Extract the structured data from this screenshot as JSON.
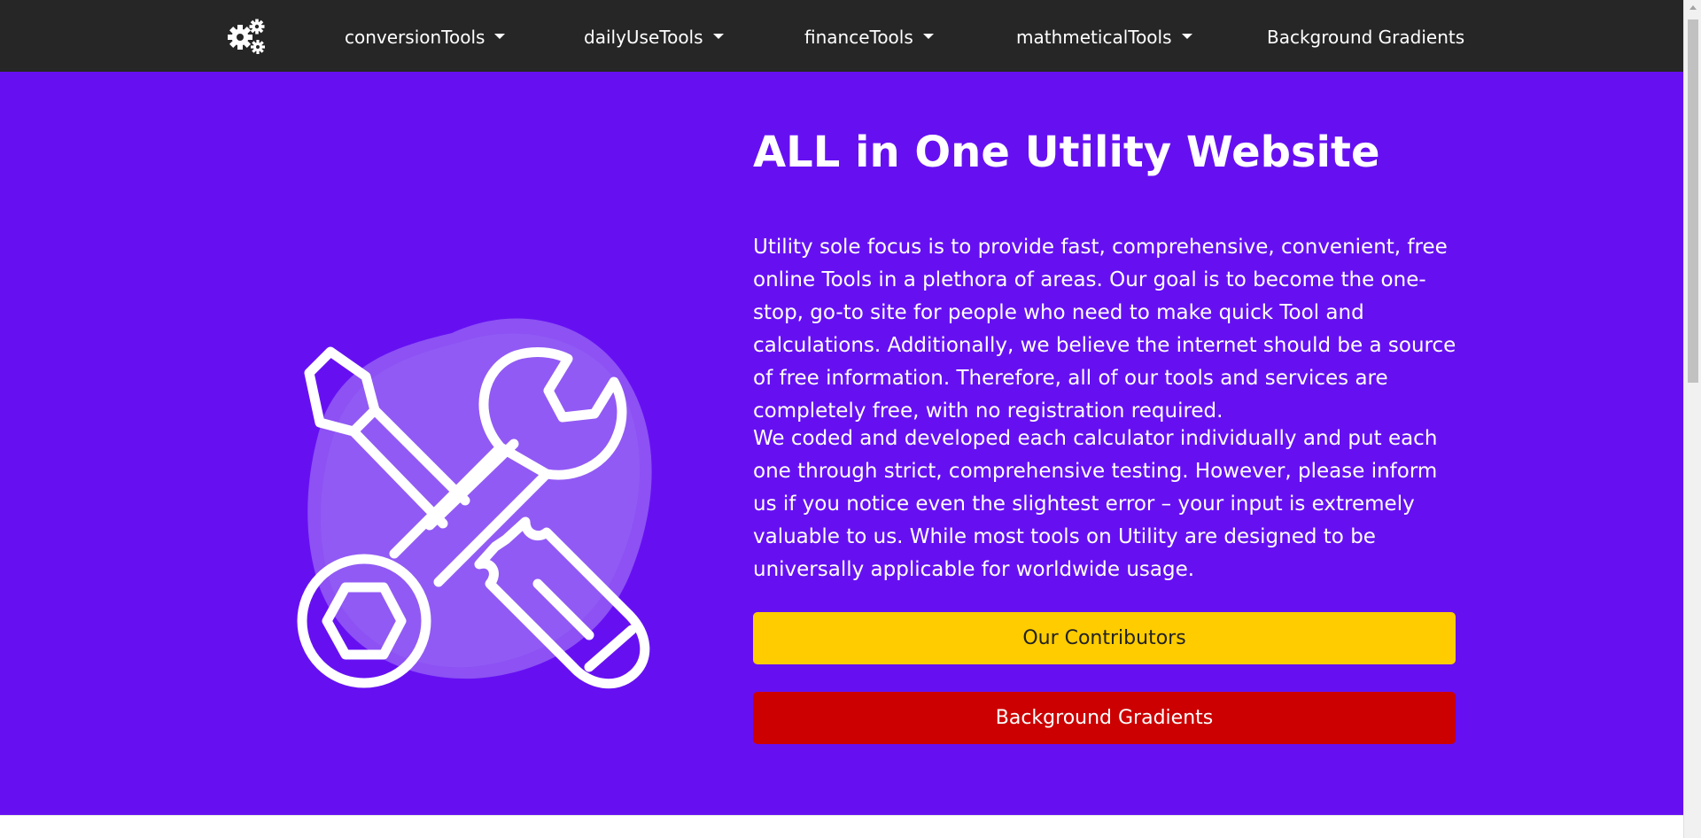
{
  "navbar": {
    "logo_icon": "gears-icon",
    "items": [
      {
        "label": "conversionTools",
        "dropdown": true
      },
      {
        "label": "dailyUseTools",
        "dropdown": true
      },
      {
        "label": "financeTools",
        "dropdown": true
      },
      {
        "label": "mathmeticalTools",
        "dropdown": true
      },
      {
        "label": "Background Gradients",
        "dropdown": false
      }
    ]
  },
  "hero": {
    "illustration_icon": "tools-wrench-screwdriver-icon",
    "title": "ALL in One Utility Website",
    "paragraph_1": "Utility sole focus is to provide fast, comprehensive, convenient, free online Tools in a plethora of areas. Our goal is to become the one-stop, go-to site for people who need to make quick Tool and calculations. Additionally, we believe the internet should be a source of free information. Therefore, all of our tools and services are completely free, with no registration required.",
    "paragraph_2": "We coded and developed each calculator individually and put each one through strict, comprehensive testing. However, please inform us if you notice even the slightest error – your input is extremely valuable to us. While most tools on Utility are designed to be universally applicable for worldwide usage.",
    "contributors_button": "Our Contributors",
    "gradients_button": "Background Gradients"
  },
  "colors": {
    "navbar_bg": "#262626",
    "hero_bg": "#6610f2",
    "blob": "#8f55f3",
    "yellow_button": "#ffcc00",
    "red_button": "#cc0000"
  }
}
